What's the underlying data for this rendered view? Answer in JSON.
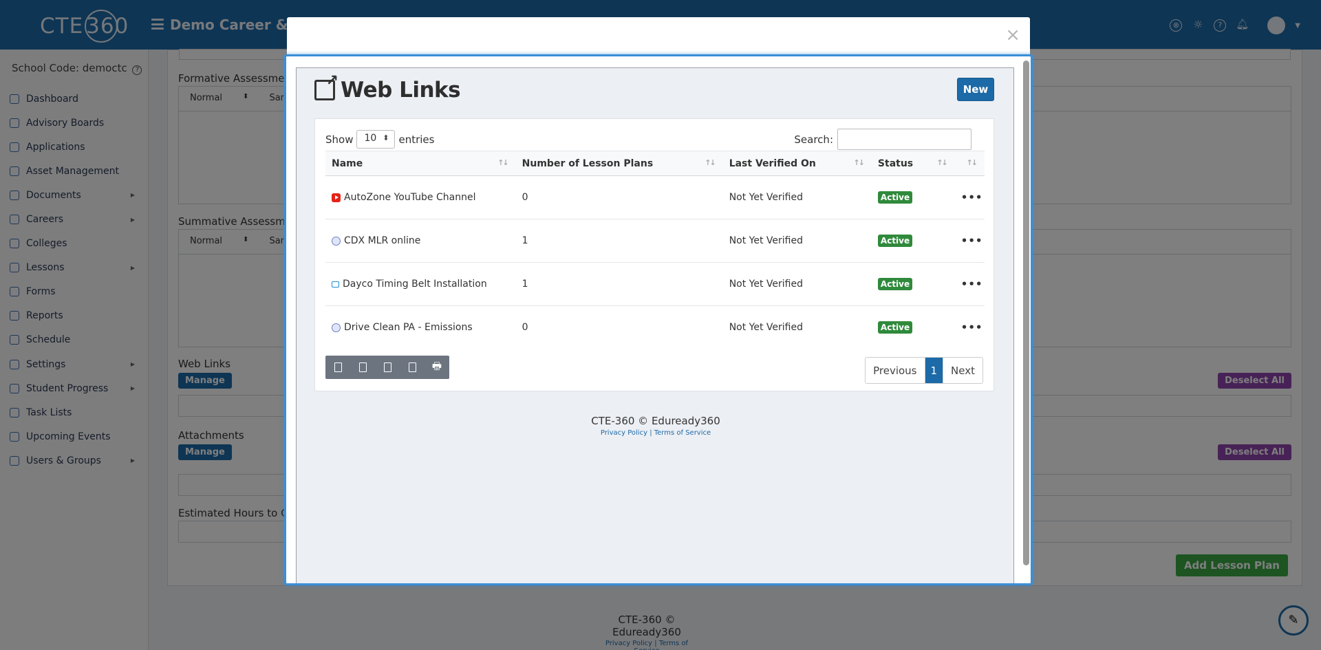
{
  "app": {
    "logo_text": "CTE",
    "logo_num": "360",
    "title": "Demo Career & Tec",
    "colors": {
      "primary": "#1c6aa8",
      "success": "#2f8a3b",
      "accent_purple": "#8e44ad"
    }
  },
  "sidebar": {
    "school_code": "School Code: democtc",
    "items": [
      {
        "label": "Dashboard",
        "icon": "dashboard-icon",
        "has_submenu": false
      },
      {
        "label": "Advisory Boards",
        "icon": "eye-icon",
        "has_submenu": false
      },
      {
        "label": "Applications",
        "icon": "document-icon",
        "has_submenu": false
      },
      {
        "label": "Asset Management",
        "icon": "chart-icon",
        "has_submenu": false
      },
      {
        "label": "Documents",
        "icon": "file-icon",
        "has_submenu": true
      },
      {
        "label": "Careers",
        "icon": "briefcase-icon",
        "has_submenu": true
      },
      {
        "label": "Colleges",
        "icon": "graduation-icon",
        "has_submenu": false
      },
      {
        "label": "Lessons",
        "icon": "presentation-icon",
        "has_submenu": true
      },
      {
        "label": "Forms",
        "icon": "form-icon",
        "has_submenu": false
      },
      {
        "label": "Reports",
        "icon": "printer-icon",
        "has_submenu": false
      },
      {
        "label": "Schedule",
        "icon": "clock-icon",
        "has_submenu": false
      },
      {
        "label": "Settings",
        "icon": "gears-icon",
        "has_submenu": true
      },
      {
        "label": "Student Progress",
        "icon": "progress-icon",
        "has_submenu": true
      },
      {
        "label": "Task Lists",
        "icon": "list-icon",
        "has_submenu": false
      },
      {
        "label": "Upcoming Events",
        "icon": "bell-icon",
        "has_submenu": false
      },
      {
        "label": "Users & Groups",
        "icon": "users-icon",
        "has_submenu": true
      }
    ]
  },
  "background_form": {
    "formative_label": "Formative Assessmen",
    "summative_label": "Summative Assessmen",
    "editor_style": "Normal",
    "editor_font": "Sans S",
    "web_links_label": "Web Links",
    "attachments_label": "Attachments",
    "manage_label": "Manage",
    "deselect_all_label": "Deselect All",
    "estimated_hours_label": "Estimated Hours to Co",
    "add_lesson_plan_label": "Add Lesson Plan"
  },
  "footer": {
    "copyright": "CTE-360 © Eduready360",
    "privacy": "Privacy Policy",
    "separator": "|",
    "terms": "Terms of Service"
  },
  "modal": {
    "close_glyph": "×",
    "title": "Web Links",
    "new_label": "New",
    "show_label": "Show",
    "entries_value": "10",
    "entries_label": "entries",
    "search_label": "Search:",
    "search_value": "",
    "columns": [
      "Name",
      "Number of Lesson Plans",
      "Last Verified On",
      "Status"
    ],
    "rows": [
      {
        "icon": "youtube-icon",
        "name": "AutoZone YouTube Channel",
        "lesson_plans": "0",
        "last_verified": "Not Yet Verified",
        "status": "Active"
      },
      {
        "icon": "globe-icon",
        "name": "CDX MLR online",
        "lesson_plans": "1",
        "last_verified": "Not Yet Verified",
        "status": "Active"
      },
      {
        "icon": "video-icon",
        "name": "Dayco Timing Belt Installation",
        "lesson_plans": "1",
        "last_verified": "Not Yet Verified",
        "status": "Active"
      },
      {
        "icon": "globe-icon",
        "name": "Drive Clean PA - Emissions",
        "lesson_plans": "0",
        "last_verified": "Not Yet Verified",
        "status": "Active"
      }
    ],
    "row_actions_glyph": "•••",
    "export_buttons": [
      "copy-icon",
      "excel-icon",
      "csv-icon",
      "pdf-icon",
      "print-icon"
    ],
    "pagination": {
      "previous": "Previous",
      "current_page": "1",
      "next": "Next"
    }
  }
}
